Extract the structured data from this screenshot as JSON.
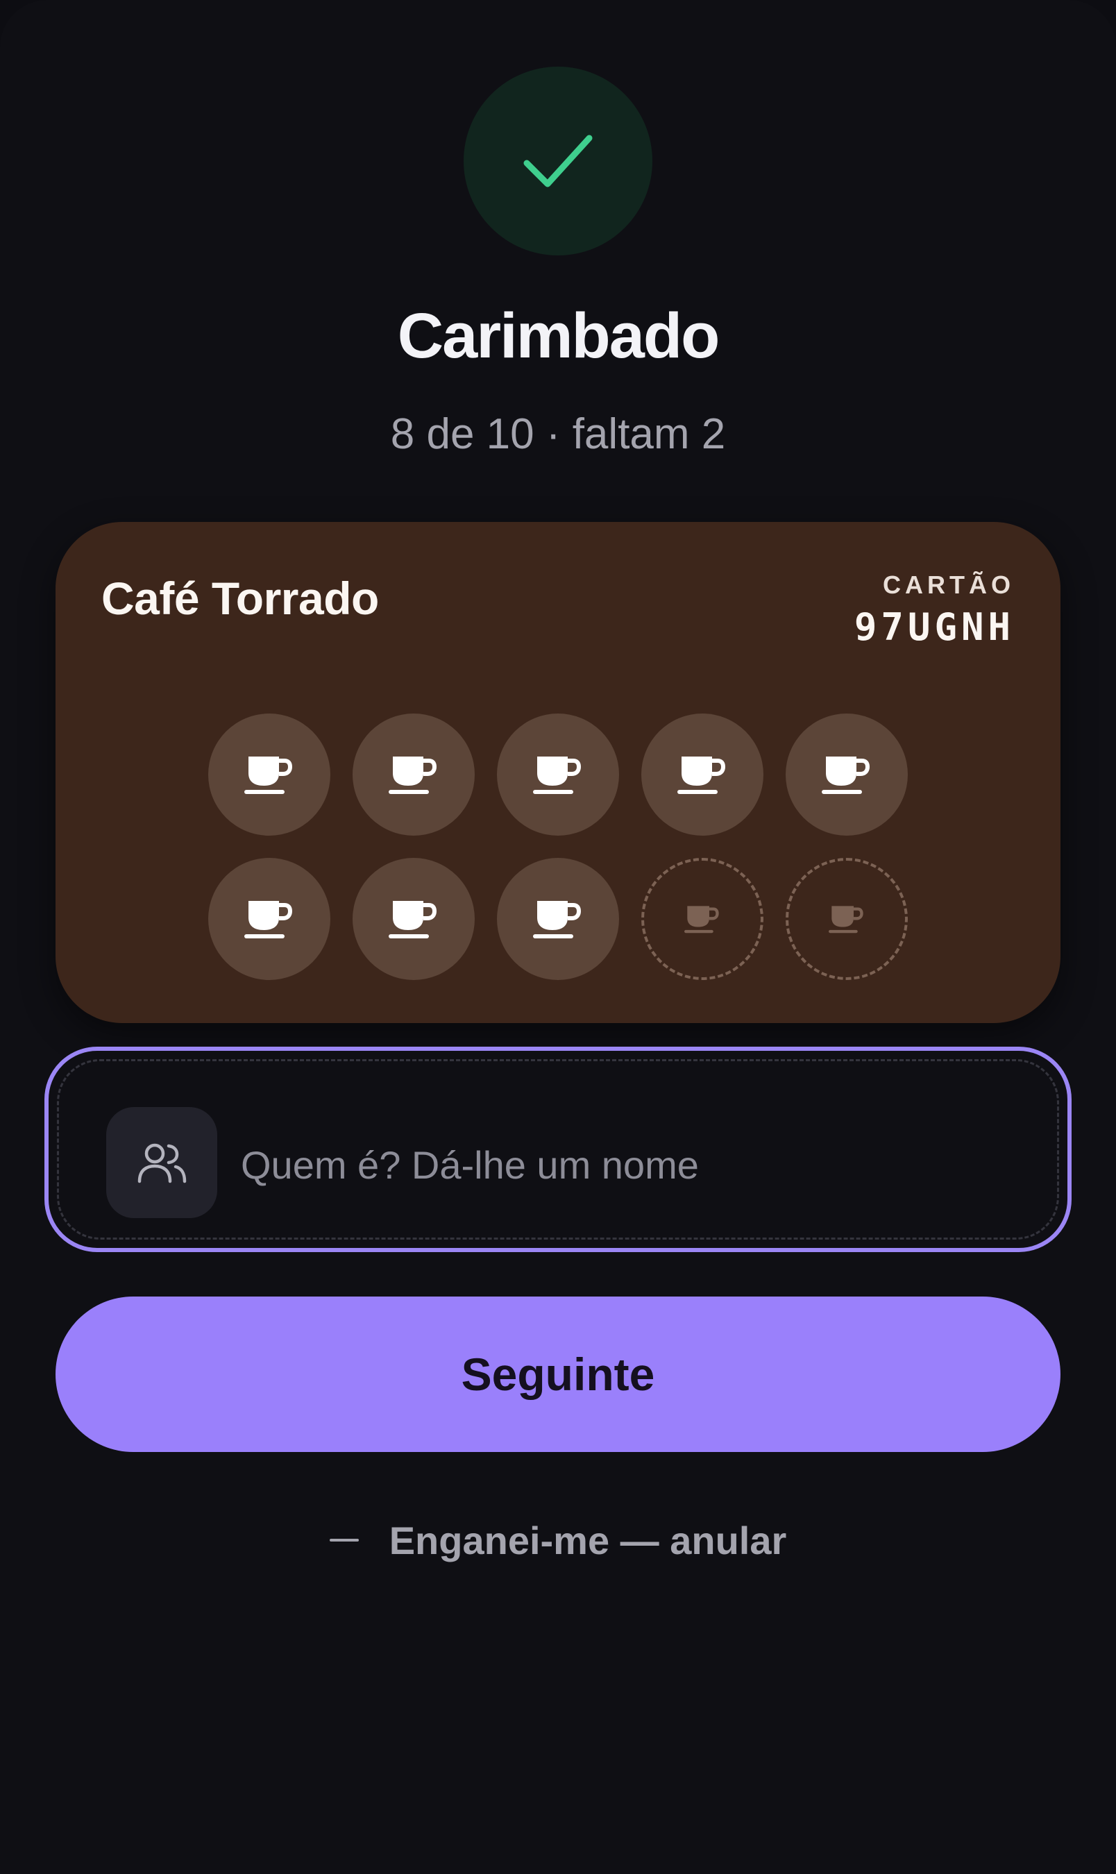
{
  "status": {
    "title": "Carimbado",
    "subtitle": "8 de 10 · faltam 2",
    "icon": "check-icon",
    "accent_color": "#3fcf8e"
  },
  "card": {
    "name": "Café Torrado",
    "code_label": "CARTÃO",
    "code": "97UGNH",
    "background_color": "#3d261b",
    "stamps_total": 10,
    "stamps_filled": 8,
    "stamp_icon": "coffee-cup-icon"
  },
  "name_field": {
    "placeholder": "Quem é? Dá-lhe um nome",
    "value": "",
    "icon": "people-icon",
    "focus_color": "#9b86f5"
  },
  "next_button": {
    "label": "Seguinte",
    "color": "#9a80fb"
  },
  "undo": {
    "label": "Enganei-me — anular"
  }
}
